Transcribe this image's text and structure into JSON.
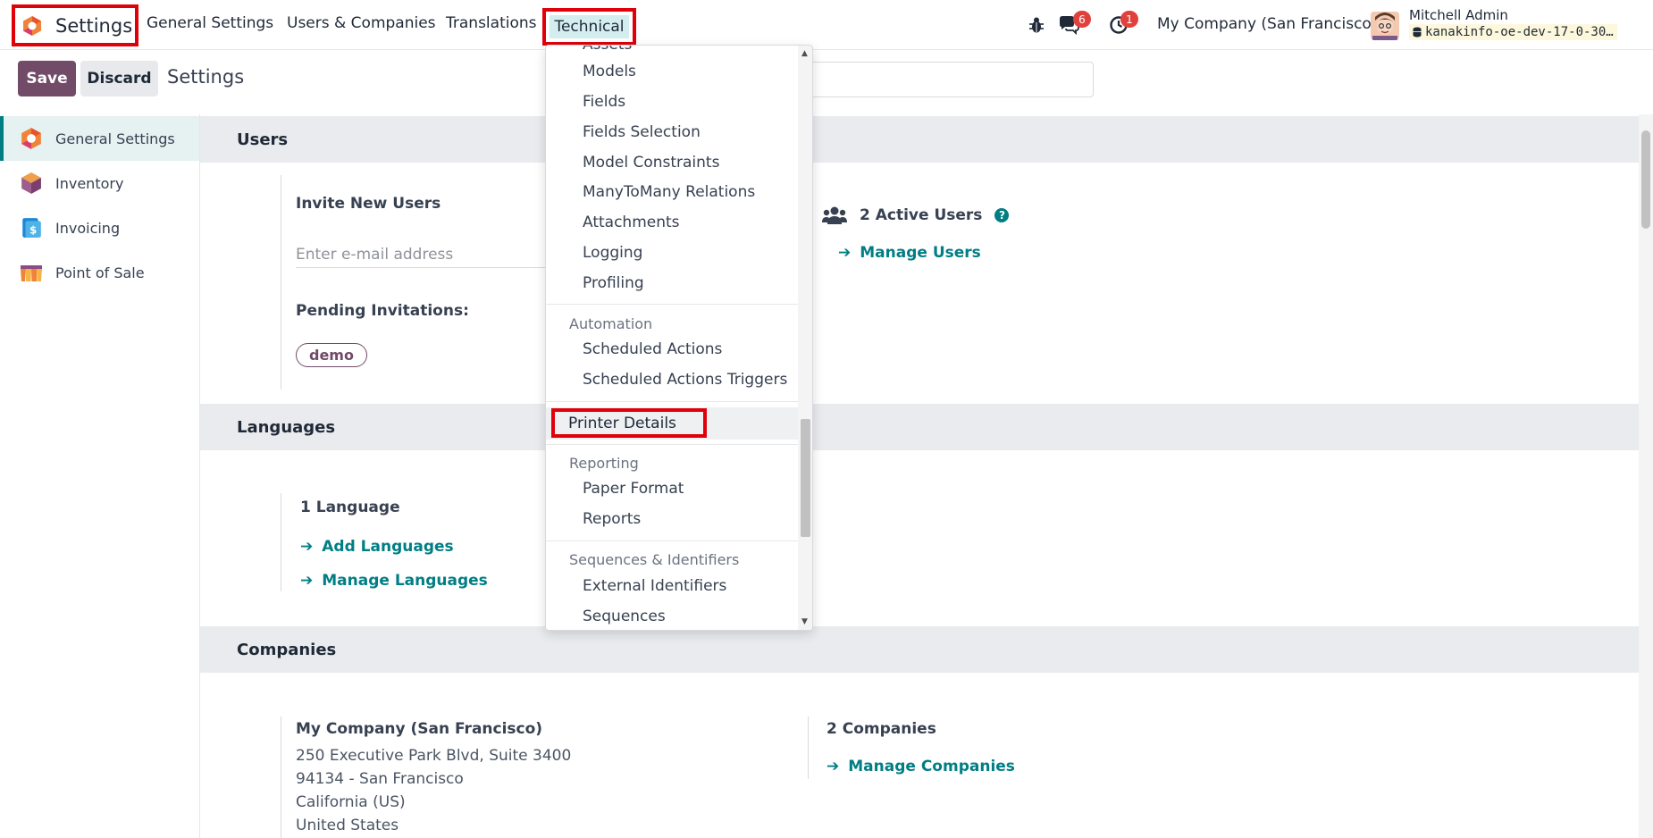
{
  "navbar": {
    "app_name": "Settings",
    "menus": [
      "General Settings",
      "Users & Companies",
      "Translations"
    ],
    "active_menu": "Technical",
    "messages_count": "6",
    "activities_count": "1",
    "company": "My Company (San Francisco)",
    "user_name": "Mitchell Admin",
    "database": "kanakinfo-oe-dev-17-0-30…"
  },
  "control_panel": {
    "save_label": "Save",
    "discard_label": "Discard",
    "breadcrumb": "Settings"
  },
  "sidebar": {
    "items": [
      {
        "label": "General Settings",
        "icon": "settings-app-icon",
        "active": true
      },
      {
        "label": "Inventory",
        "icon": "inventory-app-icon",
        "active": false
      },
      {
        "label": "Invoicing",
        "icon": "invoicing-app-icon",
        "active": false
      },
      {
        "label": "Point of Sale",
        "icon": "pos-app-icon",
        "active": false
      }
    ]
  },
  "users": {
    "section_title": "Users",
    "invite_label": "Invite New Users",
    "email_placeholder": "Enter e-mail address",
    "pending_label": "Pending Invitations:",
    "pending_tag": "demo",
    "active_users": "2 Active Users",
    "manage_users": "Manage Users"
  },
  "languages": {
    "section_title": "Languages",
    "count": "1 Language",
    "add": "Add Languages",
    "manage": "Manage Languages"
  },
  "companies": {
    "section_title": "Companies",
    "company_name": "My Company (San Francisco)",
    "address_lines": [
      "250 Executive Park Blvd, Suite 3400",
      "94134 - San Francisco",
      "California (US)",
      "United States"
    ],
    "count": "2 Companies",
    "manage": "Manage Companies"
  },
  "technical_dropdown": {
    "partial_top": "Assets",
    "database_items": [
      "Models",
      "Fields",
      "Fields Selection",
      "Model Constraints",
      "ManyToMany Relations",
      "Attachments",
      "Logging",
      "Profiling"
    ],
    "automation_header": "Automation",
    "automation_items": [
      "Scheduled Actions",
      "Scheduled Actions Triggers"
    ],
    "highlighted_item": "Printer Details",
    "reporting_header": "Reporting",
    "reporting_items": [
      "Paper Format",
      "Reports"
    ],
    "sequences_header": "Sequences & Identifiers",
    "sequences_items": [
      "External Identifiers",
      "Sequences"
    ]
  },
  "colors": {
    "brand": "#714b67",
    "accent": "#017e84",
    "highlight_border": "#e0000a",
    "badge": "#e0413d"
  }
}
